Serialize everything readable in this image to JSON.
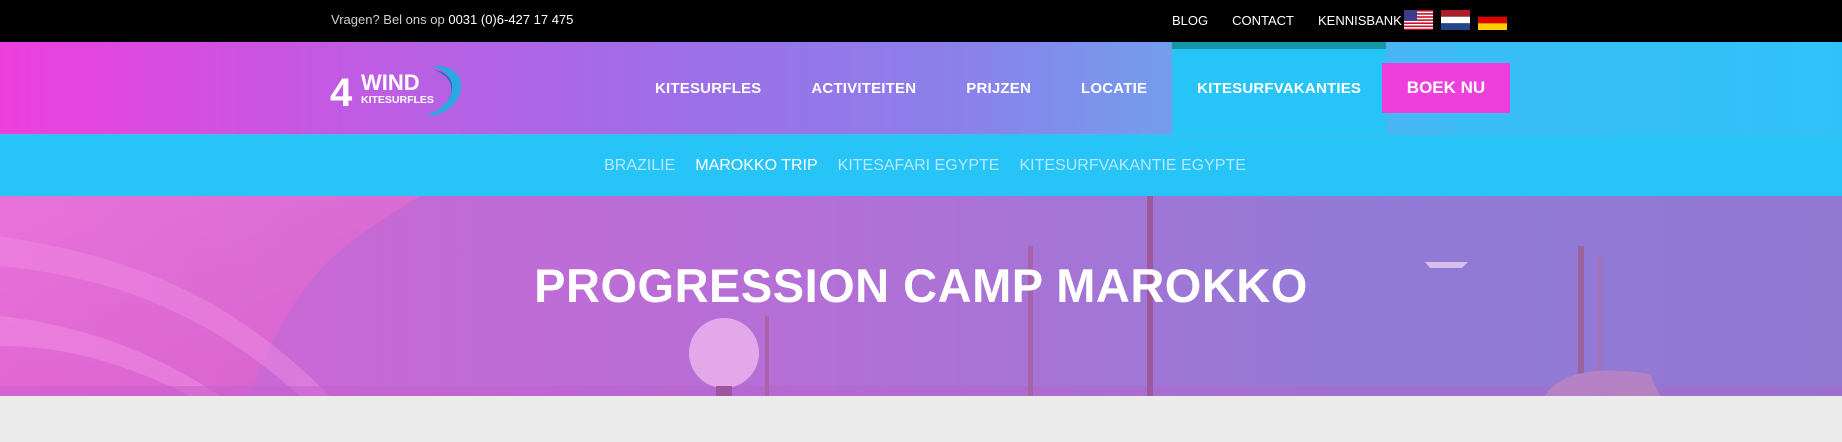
{
  "topbar": {
    "phone_prefix": "Vragen? Bel ons op",
    "phone_number": "0031 (0)6-427 17 475",
    "links": [
      "BLOG",
      "CONTACT",
      "KENNISBANK"
    ],
    "flags": [
      "us-flag-icon",
      "nl-flag-icon",
      "de-flag-icon"
    ]
  },
  "logo": {
    "number": "4",
    "word": "WIND",
    "sub": "KITESURFLES"
  },
  "nav": {
    "items": [
      "KITESURFLES",
      "ACTIVITEITEN",
      "PRIJZEN",
      "LOCATIE",
      "KITESURFVAKANTIES"
    ],
    "active_index": 4,
    "cta": "BOEK NU"
  },
  "subnav": {
    "items": [
      "BRAZILIE",
      "MAROKKO TRIP",
      "KITESAFARI EGYPTE",
      "KITESURFVAKANTIE EGYPTE"
    ],
    "active_index": 1
  },
  "hero": {
    "title": "PROGRESSION CAMP MAROKKO"
  },
  "colors": {
    "pink": "#ee3fdd",
    "cyan": "#27c4f8",
    "teal_border": "#1795a8"
  }
}
